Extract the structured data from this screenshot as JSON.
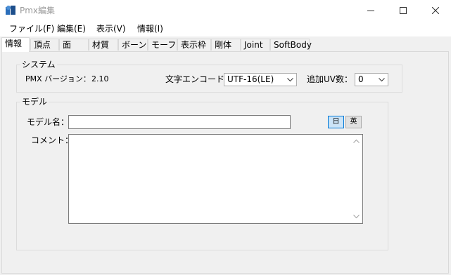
{
  "window": {
    "title": "Pmx編集",
    "icon": "pmx-app-icon",
    "controls": {
      "minimize": "minimize-icon",
      "maximize": "maximize-icon",
      "close": "close-icon"
    }
  },
  "menu": {
    "items": [
      {
        "label": "ファイル(F)"
      },
      {
        "label": "編集(E)"
      },
      {
        "label": "表示(V)"
      },
      {
        "label": "情報(I)"
      }
    ]
  },
  "tabs": [
    {
      "label": "情報",
      "active": true
    },
    {
      "label": "頂点"
    },
    {
      "label": "面"
    },
    {
      "label": "材質"
    },
    {
      "label": "ボーン"
    },
    {
      "label": "モーフ"
    },
    {
      "label": "表示枠"
    },
    {
      "label": "剛体"
    },
    {
      "label": "Joint"
    },
    {
      "label": "SoftBody"
    }
  ],
  "system": {
    "group_title": "システム",
    "pmx_version_label": "PMX バージョン：",
    "pmx_version_value": "2.10",
    "encoding_label": "文字エンコード：",
    "encoding_value": "UTF-16(LE)",
    "uv_label": "追加UV数：",
    "uv_value": "0"
  },
  "model": {
    "group_title": "モデル",
    "name_label": "モデル名：",
    "name_value": "",
    "comment_label": "コメント：",
    "comment_value": "",
    "lang_jp": "日",
    "lang_en": "英"
  },
  "colors": {
    "titlebar_bg": "#ffffff",
    "panel_bg": "#f0f0f0",
    "accent_border": "#0078d7",
    "accent_fill": "#cce4f7"
  }
}
